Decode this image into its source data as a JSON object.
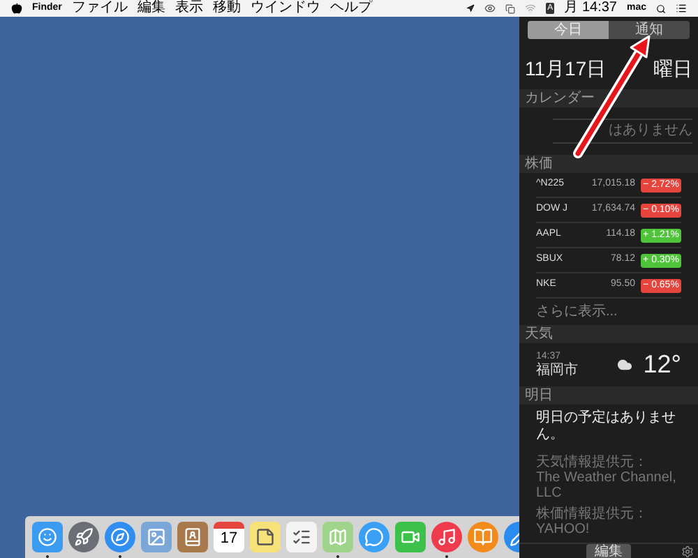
{
  "menu_bar": {
    "app": "Finder",
    "menus": [
      "ファイル",
      "編集",
      "表示",
      "移動",
      "ウインドウ",
      "ヘルプ"
    ],
    "input_mode": "A",
    "clock": "月 14:37",
    "user": "mac"
  },
  "dock": [
    {
      "kind": "finder",
      "running": true
    },
    {
      "kind": "launchpad",
      "running": false
    },
    {
      "kind": "safari",
      "running": true
    },
    {
      "kind": "preview",
      "running": false
    },
    {
      "kind": "contacts",
      "running": false
    },
    {
      "kind": "calendar",
      "running": false,
      "day": "17"
    },
    {
      "kind": "notes",
      "running": false
    },
    {
      "kind": "reminders",
      "running": false
    },
    {
      "kind": "maps",
      "running": true
    },
    {
      "kind": "messages",
      "running": false
    },
    {
      "kind": "facetime",
      "running": false
    },
    {
      "kind": "music",
      "running": true
    },
    {
      "kind": "books",
      "running": false
    },
    {
      "kind": "appstore",
      "running": false
    }
  ],
  "notification_center": {
    "tabs": [
      {
        "label": "今日",
        "selected": true
      },
      {
        "label": "通知",
        "selected": false
      }
    ],
    "date": [
      "11月17日",
      "曜日"
    ],
    "sections": [
      {
        "title": "カレンダー",
        "kind": "calendar",
        "message": "はありません"
      },
      {
        "title": "株価",
        "kind": "stocks",
        "rows": [
          {
            "symbol": "^N225",
            "price": "17,015.18",
            "change": "− 2.72%",
            "color": "#e5453d"
          },
          {
            "symbol": "DOW J",
            "price": "17,634.74",
            "change": "− 0.10%",
            "color": "#e5453d"
          },
          {
            "symbol": "AAPL",
            "price": "114.18",
            "change": "+ 1.21%",
            "color": "#4fc43a"
          },
          {
            "symbol": "SBUX",
            "price": "78.12",
            "change": "+ 0.30%",
            "color": "#4fc43a"
          },
          {
            "symbol": "NKE",
            "price": "95.50",
            "change": "− 0.65%",
            "color": "#e5453d"
          }
        ],
        "more": "さらに表示..."
      },
      {
        "title": "天気",
        "kind": "weather",
        "time": "14:37",
        "city": "福岡市",
        "temperature": "12°"
      },
      {
        "title": "明日",
        "kind": "tomorrow",
        "message": "明日の予定はありません。",
        "credits": [
          "天気情報提供元：",
          "The Weather Channel, LLC",
          "株価情報提供元： YAHOO!"
        ]
      }
    ],
    "edit_button": "編集"
  }
}
